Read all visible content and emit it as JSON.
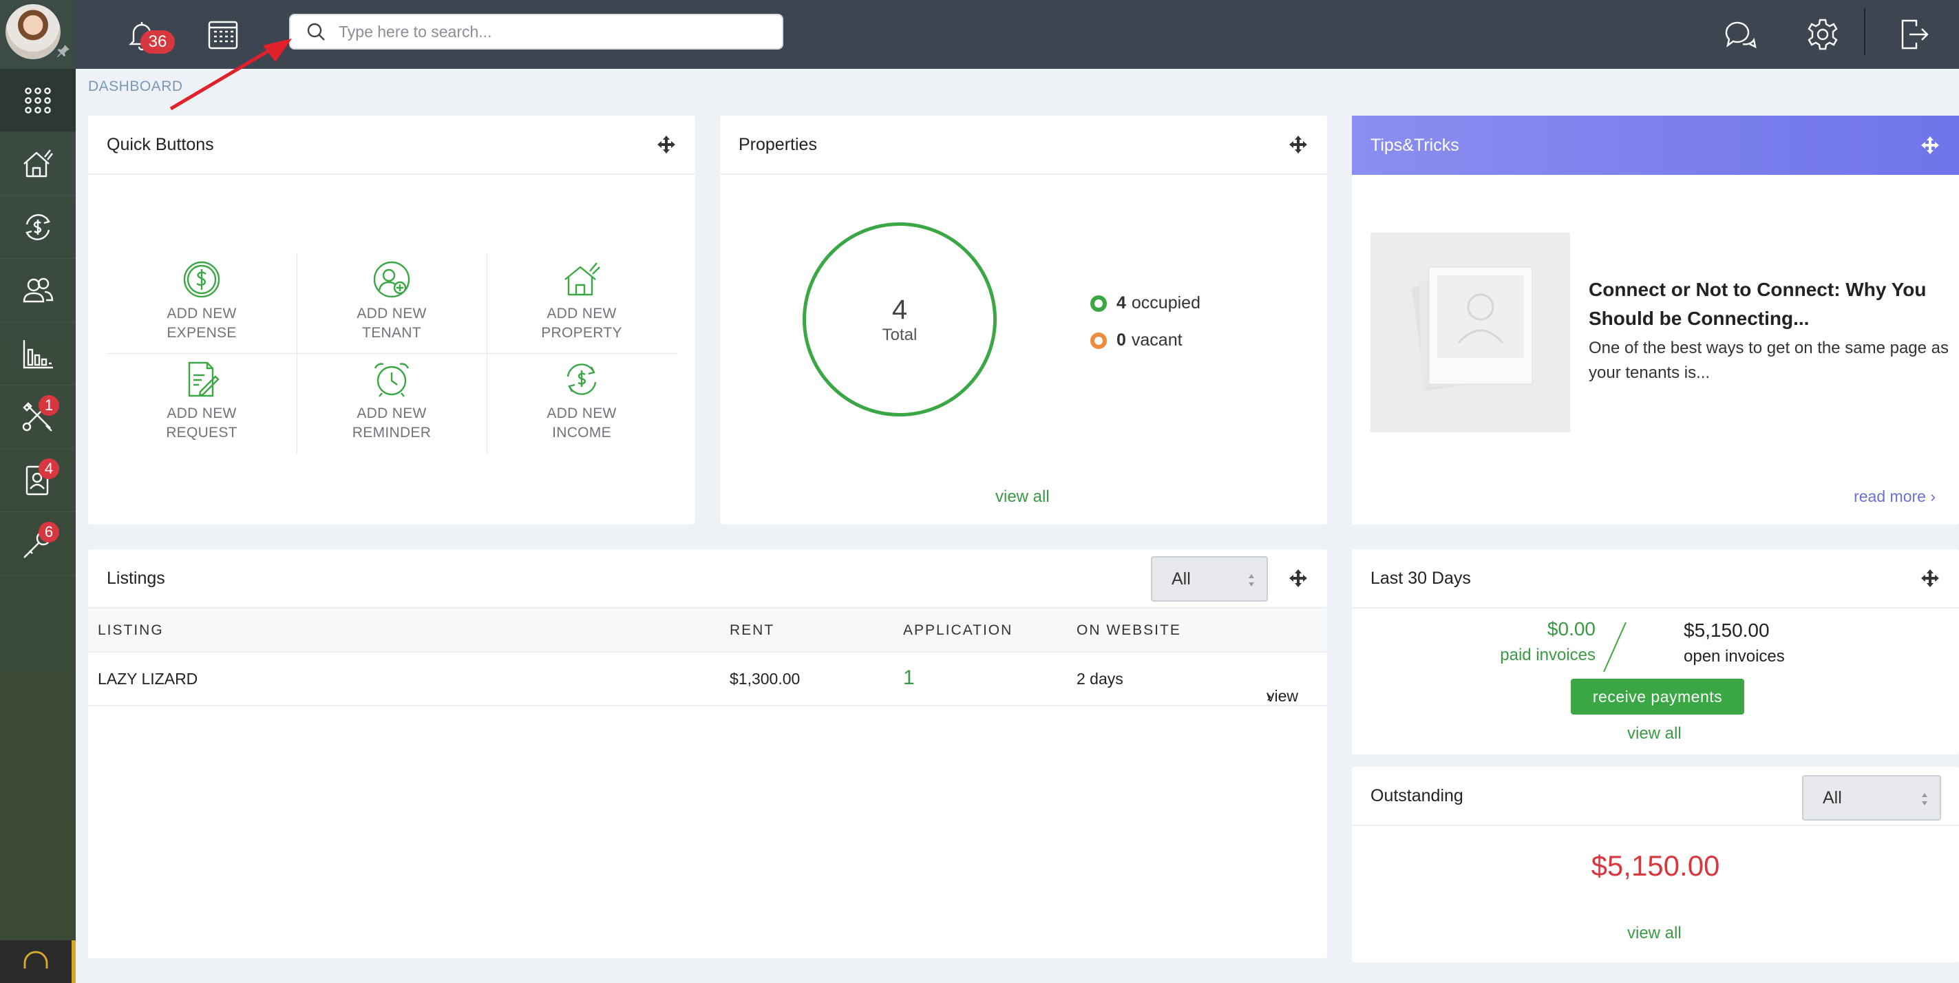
{
  "topbar": {
    "notification_count": "36",
    "search_placeholder": "Type here to search..."
  },
  "breadcrumb": "DASHBOARD",
  "sidebar": {
    "items": [
      {
        "name": "apps-grid",
        "badge": ""
      },
      {
        "name": "properties",
        "badge": ""
      },
      {
        "name": "accounting",
        "badge": ""
      },
      {
        "name": "tenants",
        "badge": ""
      },
      {
        "name": "reports",
        "badge": ""
      },
      {
        "name": "maintenance",
        "badge": "1"
      },
      {
        "name": "applicants",
        "badge": "4"
      },
      {
        "name": "tools",
        "badge": "6"
      }
    ]
  },
  "quick_buttons": {
    "title": "Quick Buttons",
    "items": [
      {
        "l1": "ADD NEW",
        "l2": "EXPENSE",
        "icon": "dollar-circle-icon"
      },
      {
        "l1": "ADD NEW",
        "l2": "TENANT",
        "icon": "add-user-icon"
      },
      {
        "l1": "ADD NEW",
        "l2": "PROPERTY",
        "icon": "house-icon"
      },
      {
        "l1": "ADD NEW",
        "l2": "REQUEST",
        "icon": "document-edit-icon"
      },
      {
        "l1": "ADD NEW",
        "l2": "REMINDER",
        "icon": "alarm-clock-icon"
      },
      {
        "l1": "ADD NEW",
        "l2": "INCOME",
        "icon": "dollar-refresh-icon"
      }
    ]
  },
  "properties": {
    "title": "Properties",
    "total": "4",
    "total_label": "Total",
    "occupied_count": "4",
    "occupied_label": "occupied",
    "vacant_count": "0",
    "vacant_label": "vacant",
    "view_all": "view all",
    "colors": {
      "occupied": "#3aa744",
      "vacant": "#f08a3c"
    }
  },
  "tips": {
    "title": "Tips&Tricks",
    "headline": "Connect or Not to Connect: Why You Should be Connecting...",
    "body": "One of the best ways to get on the same page as your tenants is...",
    "read_more": "read more"
  },
  "listings": {
    "title": "Listings",
    "filter": "All",
    "columns": [
      "LISTING",
      "RENT",
      "APPLICATION",
      "ON WEBSITE"
    ],
    "rows": [
      {
        "listing": "LAZY LIZARD",
        "rent": "$1,300.00",
        "application": "1",
        "on_website": "2 days",
        "action": "view"
      }
    ]
  },
  "last30": {
    "title": "Last 30 Days",
    "paid_amount": "$0.00",
    "paid_label": "paid invoices",
    "open_amount": "$5,150.00",
    "open_label": "open invoices",
    "button": "receive payments",
    "view_all": "view all"
  },
  "outstanding": {
    "title": "Outstanding",
    "filter": "All",
    "amount": "$5,150.00",
    "view_all": "view all"
  }
}
